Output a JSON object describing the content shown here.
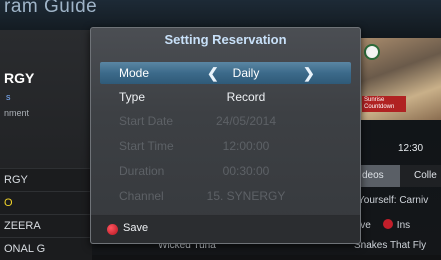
{
  "guide": {
    "title": "ram Guide",
    "channel_name": "RGY",
    "channel_sub": "s",
    "channel_desc": "nment",
    "clock": "12:30",
    "channels": [
      "RGY",
      "O",
      "ZEERA",
      "ONAL G"
    ],
    "tabs": {
      "active": "deos",
      "other": "Colle"
    },
    "program_line": "Yourself: Carniv",
    "row2": {
      "left": "ive",
      "right": "Ins"
    },
    "row3": {
      "left": "Wicked Tuna",
      "right": "Snakes That Fly"
    },
    "video": {
      "caption": "Sunrise Countdown"
    }
  },
  "dialog": {
    "title": "Setting Reservation",
    "rows": [
      {
        "label": "Mode",
        "value": "Daily"
      },
      {
        "label": "Type",
        "value": "Record"
      },
      {
        "label": "Start Date",
        "value": "24/05/2014"
      },
      {
        "label": "Start Time",
        "value": "12:00:00"
      },
      {
        "label": "Duration",
        "value": "00:30:00"
      },
      {
        "label": "Channel",
        "value": "15. SYNERGY"
      }
    ],
    "arrows": {
      "left": "❮",
      "right": "❯"
    },
    "footer": {
      "save_label": "Save"
    }
  }
}
